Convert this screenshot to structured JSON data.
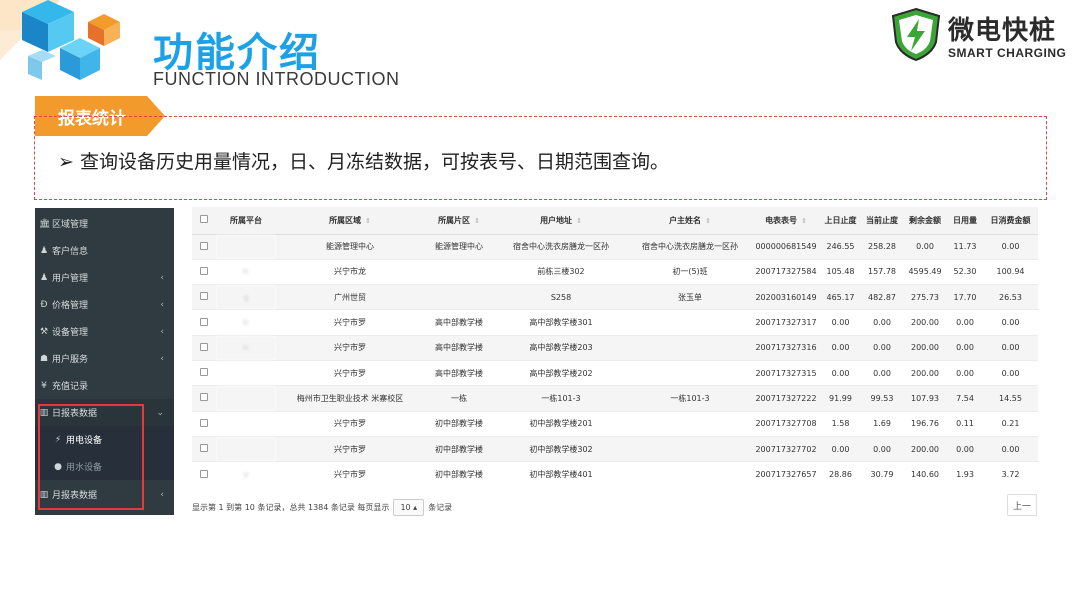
{
  "header": {
    "title_cn": "功能介绍",
    "title_en": "FUNCTION INTRODUCTION"
  },
  "brand": {
    "name": "微电快桩",
    "sub": "SMART CHARGING",
    "color": "#3aa635"
  },
  "section": {
    "tag": "报表统计",
    "desc": "➢ 查询设备历史用量情况，日、月冻结数据，可按表号、日期范围查询。",
    "tag_color": "#f39a2c",
    "accent": "#1da1e6"
  },
  "sidebar": {
    "items": [
      {
        "icon": "bank-icon",
        "glyph": "🏛",
        "label": "区域管理",
        "chev": ""
      },
      {
        "icon": "user-icon",
        "glyph": "♟",
        "label": "客户信息",
        "chev": ""
      },
      {
        "icon": "users-icon",
        "glyph": "♟",
        "label": "用户管理",
        "chev": "‹"
      },
      {
        "icon": "yen-icon",
        "glyph": "Ð",
        "label": "价格管理",
        "chev": "‹"
      },
      {
        "icon": "wrench-icon",
        "glyph": "⚒",
        "label": "设备管理",
        "chev": "‹"
      },
      {
        "icon": "service-icon",
        "glyph": "☗",
        "label": "用户服务",
        "chev": "‹"
      },
      {
        "icon": "recharge-icon",
        "glyph": "¥",
        "label": "充值记录",
        "chev": ""
      },
      {
        "icon": "chart-icon",
        "glyph": "▥",
        "label": "日报表数据",
        "chev": "⌄"
      },
      {
        "icon": "bolt-icon",
        "glyph": "⚡",
        "label": "用电设备",
        "chev": ""
      },
      {
        "icon": "drop-icon",
        "glyph": "●",
        "label": "用水设备",
        "chev": ""
      },
      {
        "icon": "chart-icon",
        "glyph": "▥",
        "label": "月报表数据",
        "chev": "‹"
      }
    ]
  },
  "table": {
    "columns": [
      "",
      "所属平台",
      "所属区域",
      "所属片区",
      "用户地址",
      "户主姓名",
      "电表表号",
      "上日止度",
      "当前止度",
      "剩余金额",
      "日用量",
      "日消费金额"
    ],
    "rows": [
      [
        "",
        "",
        "能源管理中心",
        "能源管理中心",
        "宿舍中心洗衣房膳龙一区孙",
        "宿舍中心洗衣房膳龙一区孙",
        "000000681549",
        "246.55",
        "258.28",
        "0.00",
        "11.73",
        "0.00"
      ],
      [
        "",
        "lc",
        "兴宁市龙",
        "",
        "前栋三楼302",
        "初一(5)班",
        "200717327584",
        "105.48",
        "157.78",
        "4595.49",
        "52.30",
        "100.94"
      ],
      [
        "",
        "g",
        "广州世贸",
        "",
        "S258",
        "张玉单",
        "202003160149",
        "465.17",
        "482.87",
        "275.73",
        "17.70",
        "26.53"
      ],
      [
        "",
        "lc",
        "兴宁市罗",
        "高中部教学楼",
        "高中部教学楼301",
        "",
        "200717327317",
        "0.00",
        "0.00",
        "200.00",
        "0.00",
        "0.00"
      ],
      [
        "",
        "lc",
        "兴宁市罗",
        "高中部教学楼",
        "高中部教学楼203",
        "",
        "200717327316",
        "0.00",
        "0.00",
        "200.00",
        "0.00",
        "0.00"
      ],
      [
        "",
        "",
        "兴宁市罗",
        "高中部教学楼",
        "高中部教学楼202",
        "",
        "200717327315",
        "0.00",
        "0.00",
        "200.00",
        "0.00",
        "0.00"
      ],
      [
        "",
        "",
        "梅州市卫生职业技术 米寨校区",
        "一栋",
        "一栋101-3",
        "一栋101-3",
        "200717327222",
        "91.99",
        "99.53",
        "107.93",
        "7.54",
        "14.55"
      ],
      [
        "",
        "",
        "兴宁市罗",
        "初中部教学楼",
        "初中部教学楼201",
        "",
        "200717327708",
        "1.58",
        "1.69",
        "196.76",
        "0.11",
        "0.21"
      ],
      [
        "",
        "",
        "兴宁市罗",
        "初中部教学楼",
        "初中部教学楼302",
        "",
        "200717327702",
        "0.00",
        "0.00",
        "200.00",
        "0.00",
        "0.00"
      ],
      [
        "",
        "y",
        "兴宁市罗",
        "初中部教学楼",
        "初中部教学楼401",
        "",
        "200717327657",
        "28.86",
        "30.79",
        "140.60",
        "1.93",
        "3.72"
      ]
    ]
  },
  "pager": {
    "info": "显示第 1 到第 10 条记录，总共 1384 条记录 每页显示",
    "page_size": "10 ▴",
    "suffix": "条记录",
    "prev": "上一"
  }
}
